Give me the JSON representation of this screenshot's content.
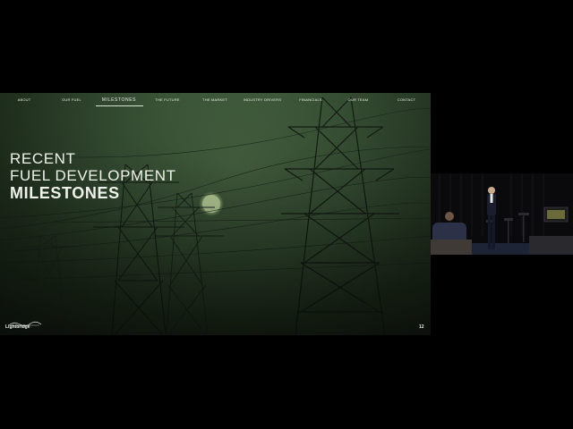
{
  "slide": {
    "nav": [
      {
        "label": "ABOUT",
        "active": false
      },
      {
        "label": "OUR FUEL",
        "active": false
      },
      {
        "label": "MILESTONES",
        "active": true
      },
      {
        "label": "THE FUTURE",
        "active": false
      },
      {
        "label": "THE MARKET",
        "active": false
      },
      {
        "label": "INDUSTRY DRIVERS",
        "active": false
      },
      {
        "label": "FINANCIALS",
        "active": false
      },
      {
        "label": "OUR TEAM",
        "active": false
      },
      {
        "label": "CONTACT",
        "active": false
      }
    ],
    "title": {
      "line1": "RECENT",
      "line2": "FUEL DEVELOPMENT",
      "line3": "MILESTONES"
    },
    "brand": "Lightbridge",
    "page_number": "12"
  },
  "colors": {
    "slide_bg": "#3a5437",
    "sun": "#c9e3a8",
    "text": "#eef2ea"
  }
}
